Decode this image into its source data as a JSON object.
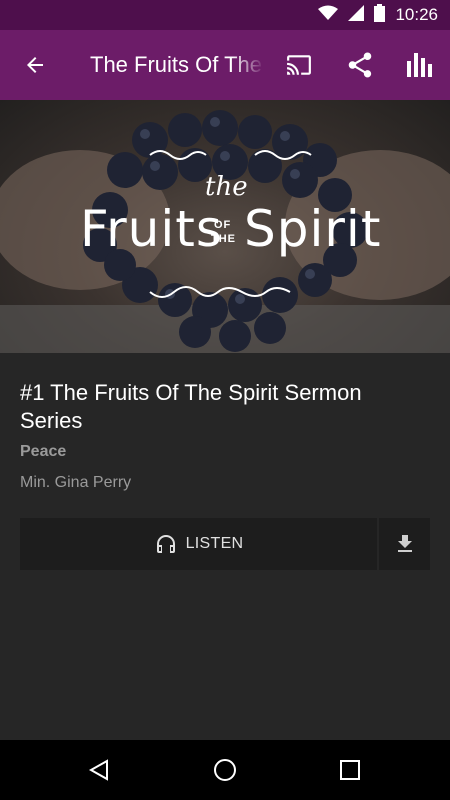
{
  "status_bar": {
    "time": "10:26",
    "icons": [
      "wifi-icon",
      "signal-icon",
      "battery-icon"
    ]
  },
  "app_bar": {
    "title": "The Fruits Of The Spirit Sermon Series",
    "actions": [
      "cast-icon",
      "share-icon",
      "equalizer-icon"
    ],
    "color": "#6c1c68"
  },
  "hero": {
    "line1": "the",
    "line2_left": "Fruits",
    "line2_small_top": "OF",
    "line2_small_bottom": "THE",
    "line2_right": "Spirit"
  },
  "episode": {
    "title": "#1 The Fruits Of The Spirit  Sermon Series",
    "subtitle": "Peace",
    "speaker": "Min. Gina Perry"
  },
  "actions": {
    "listen_label": "LISTEN",
    "download_icon": "download-icon"
  },
  "nav_bar": {
    "buttons": [
      "back-triangle-icon",
      "home-circle-icon",
      "recents-square-icon"
    ]
  }
}
